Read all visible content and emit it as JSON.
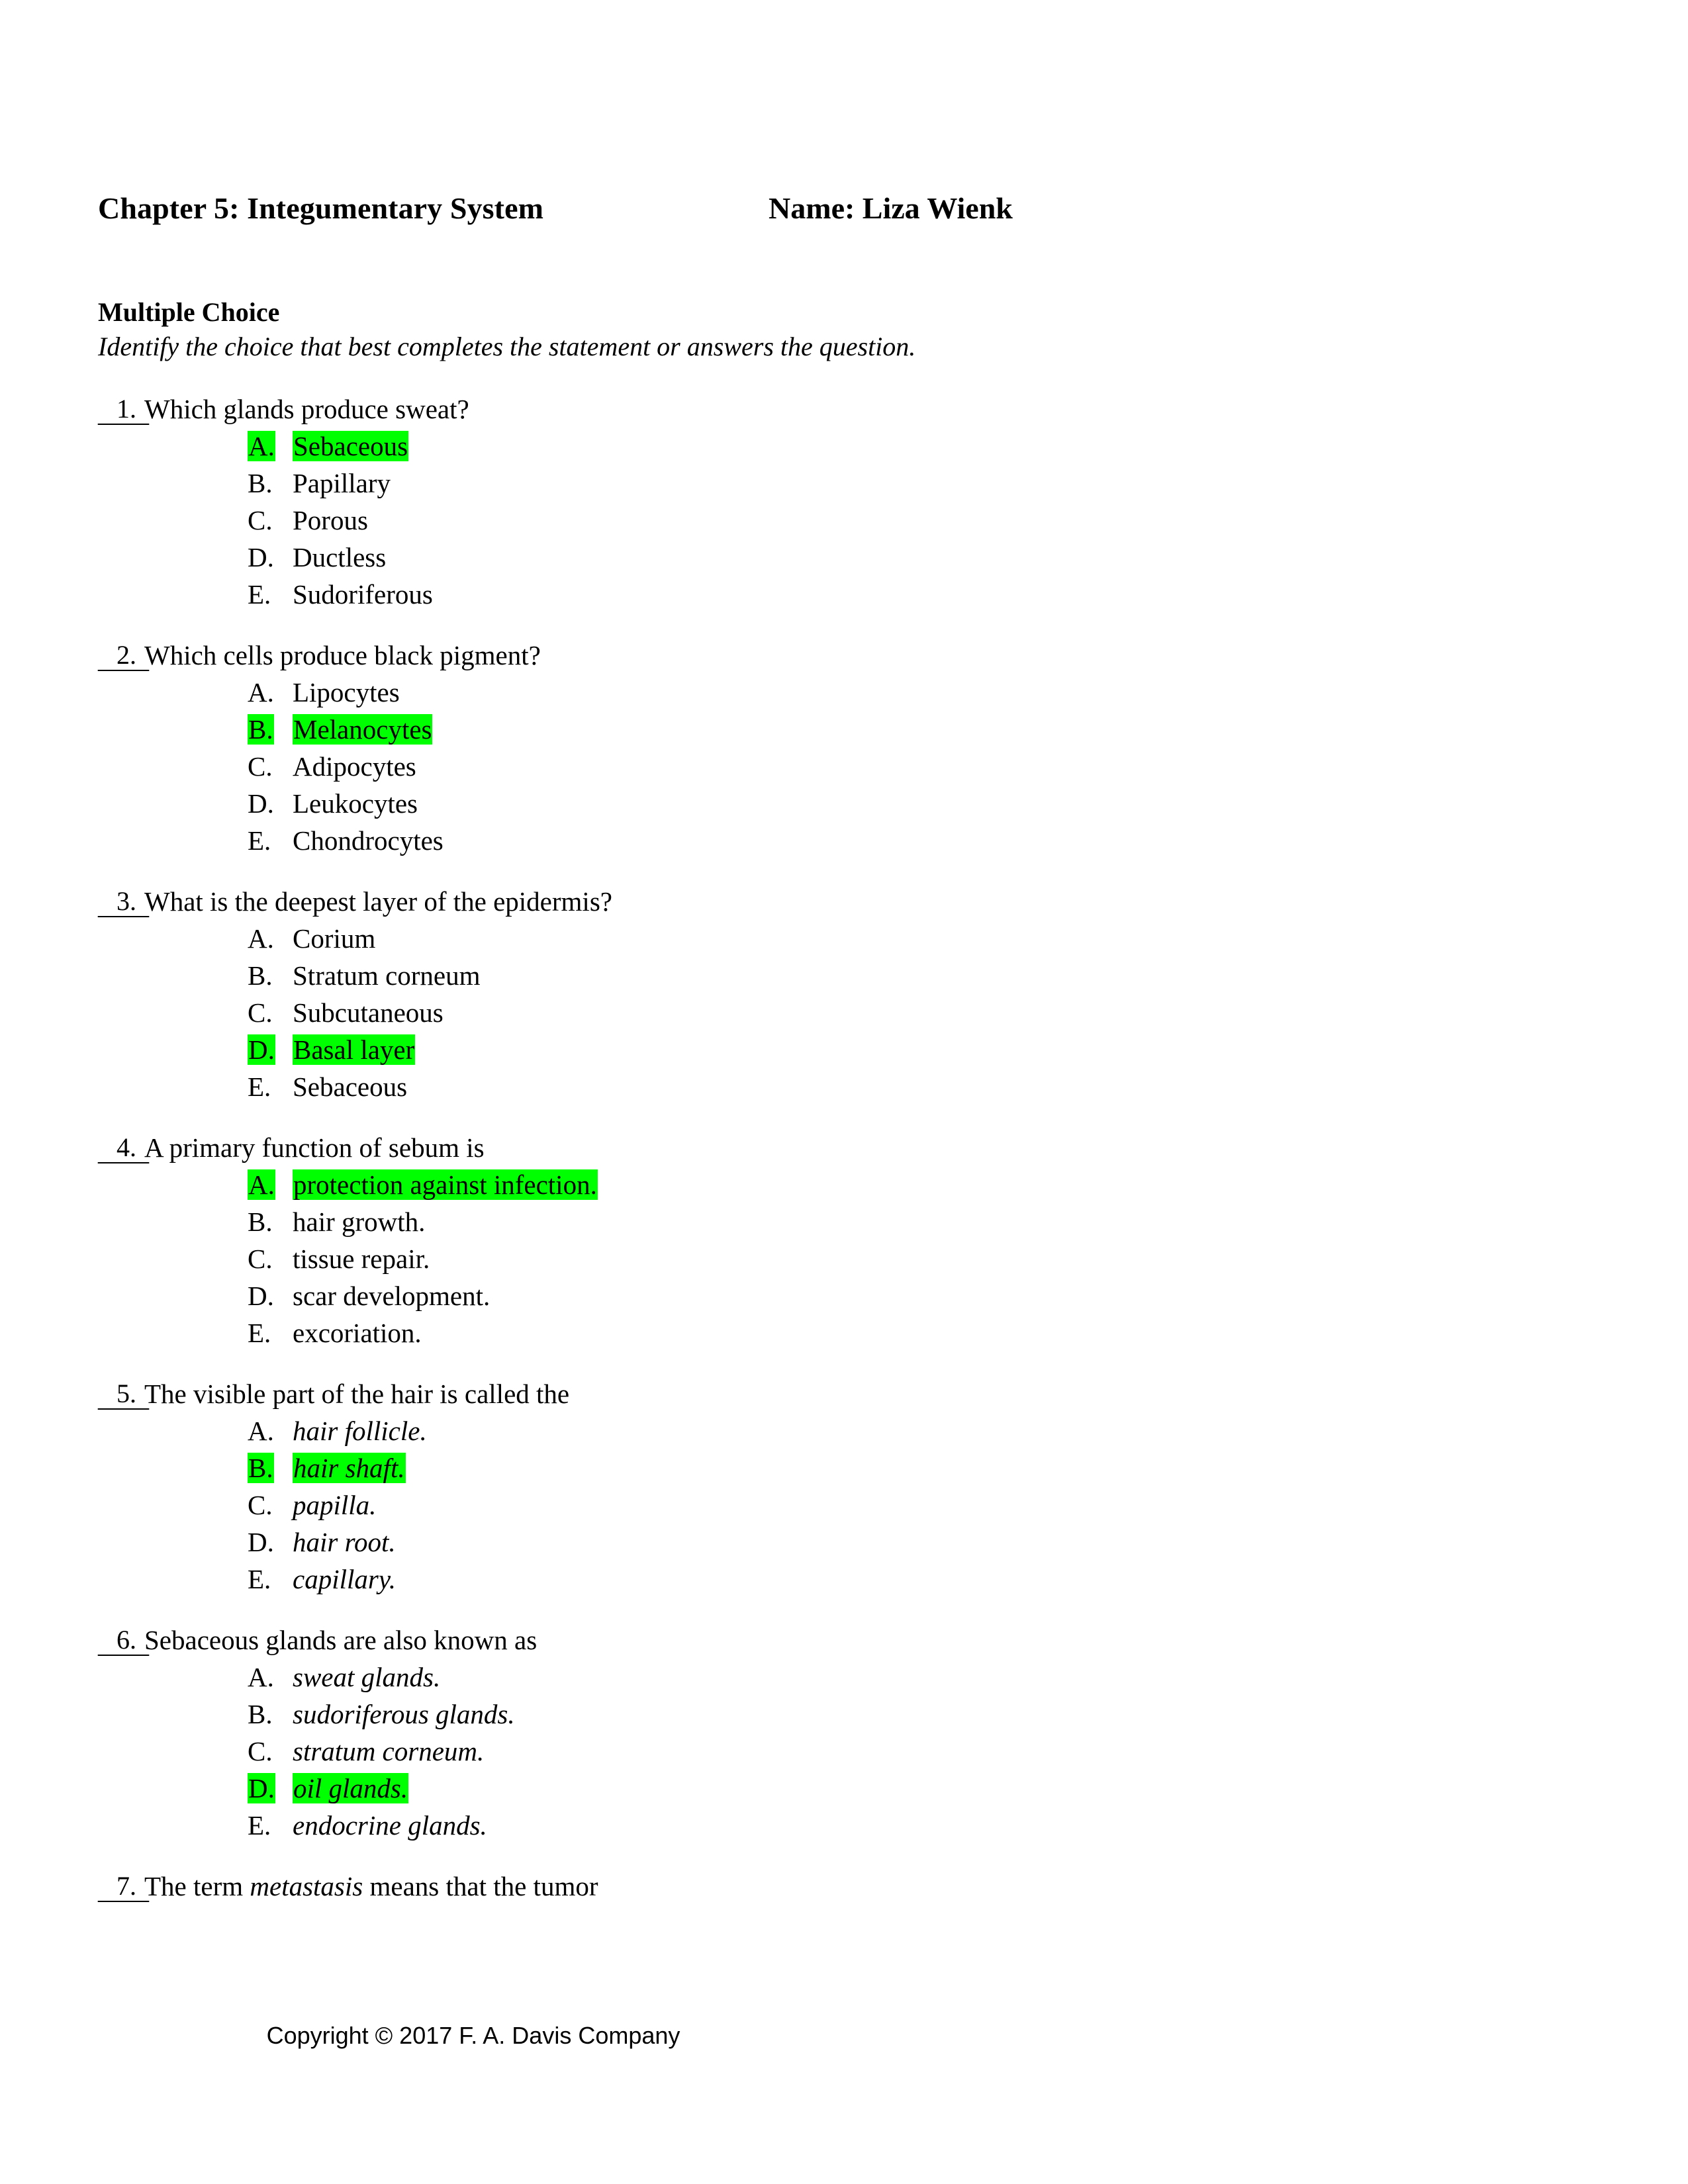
{
  "header": {
    "doc_title": "Chapter 5: Integumentary System",
    "name_label": "Name: Liza Wienk"
  },
  "section": {
    "heading": "Multiple Choice",
    "instruction": "Identify the choice that best completes the statement or answers the question."
  },
  "answer_blank": "____",
  "highlight_color": "#00ff00",
  "questions": [
    {
      "number": "1.",
      "text": "Which glands produce sweat?",
      "italic_options": false,
      "options": [
        {
          "letter": "A.",
          "text": "Sebaceous",
          "highlighted": true
        },
        {
          "letter": "B.",
          "text": "Papillary",
          "highlighted": false
        },
        {
          "letter": "C.",
          "text": "Porous",
          "highlighted": false
        },
        {
          "letter": "D.",
          "text": "Ductless",
          "highlighted": false
        },
        {
          "letter": "E.",
          "text": "Sudoriferous",
          "highlighted": false
        }
      ]
    },
    {
      "number": "2.",
      "text": "Which cells produce black pigment?",
      "italic_options": false,
      "options": [
        {
          "letter": "A.",
          "text": "Lipocytes",
          "highlighted": false
        },
        {
          "letter": "B.",
          "text": "Melanocytes",
          "highlighted": true
        },
        {
          "letter": "C.",
          "text": "Adipocytes",
          "highlighted": false
        },
        {
          "letter": "D.",
          "text": "Leukocytes",
          "highlighted": false
        },
        {
          "letter": "E.",
          "text": "Chondrocytes",
          "highlighted": false
        }
      ]
    },
    {
      "number": "3.",
      "text": "What is the deepest layer of the epidermis?",
      "italic_options": false,
      "options": [
        {
          "letter": "A.",
          "text": "Corium",
          "highlighted": false
        },
        {
          "letter": "B.",
          "text": "Stratum corneum",
          "highlighted": false
        },
        {
          "letter": "C.",
          "text": "Subcutaneous",
          "highlighted": false
        },
        {
          "letter": "D.",
          "text": "Basal layer",
          "highlighted": true
        },
        {
          "letter": "E.",
          "text": "Sebaceous",
          "highlighted": false
        }
      ]
    },
    {
      "number": "4.",
      "text": "A primary function of sebum is",
      "italic_options": false,
      "options": [
        {
          "letter": "A.",
          "text": "protection against infection.",
          "highlighted": true
        },
        {
          "letter": "B.",
          "text": "hair growth.",
          "highlighted": false
        },
        {
          "letter": "C.",
          "text": "tissue repair.",
          "highlighted": false
        },
        {
          "letter": "D.",
          "text": "scar development.",
          "highlighted": false
        },
        {
          "letter": "E.",
          "text": "excoriation.",
          "highlighted": false
        }
      ]
    },
    {
      "number": "5.",
      "text": "The visible part of the hair is called the",
      "italic_options": true,
      "options": [
        {
          "letter": "A.",
          "text": "hair follicle.",
          "highlighted": false
        },
        {
          "letter": "B.",
          "text": "hair shaft.",
          "highlighted": true
        },
        {
          "letter": "C.",
          "text": "papilla.",
          "highlighted": false
        },
        {
          "letter": "D.",
          "text": "hair root.",
          "highlighted": false
        },
        {
          "letter": "E.",
          "text": "capillary.",
          "highlighted": false
        }
      ]
    },
    {
      "number": "6.",
      "text": "Sebaceous glands are also known as",
      "italic_options": true,
      "options": [
        {
          "letter": "A.",
          "text": "sweat glands.",
          "highlighted": false
        },
        {
          "letter": "B.",
          "text": "sudoriferous glands.",
          "highlighted": false
        },
        {
          "letter": "C.",
          "text": "stratum corneum.",
          "highlighted": false
        },
        {
          "letter": "D.",
          "text": "oil glands.",
          "highlighted": true
        },
        {
          "letter": "E.",
          "text": "endocrine glands.",
          "highlighted": false
        }
      ]
    },
    {
      "number": "7.",
      "text_parts": [
        {
          "text": "The term ",
          "italic": false
        },
        {
          "text": "metastasis",
          "italic": true
        },
        {
          "text": " means that the tumor",
          "italic": false
        }
      ],
      "italic_options": false,
      "options": []
    }
  ],
  "footer": {
    "copyright": "Copyright © 2017 F. A. Davis Company"
  }
}
